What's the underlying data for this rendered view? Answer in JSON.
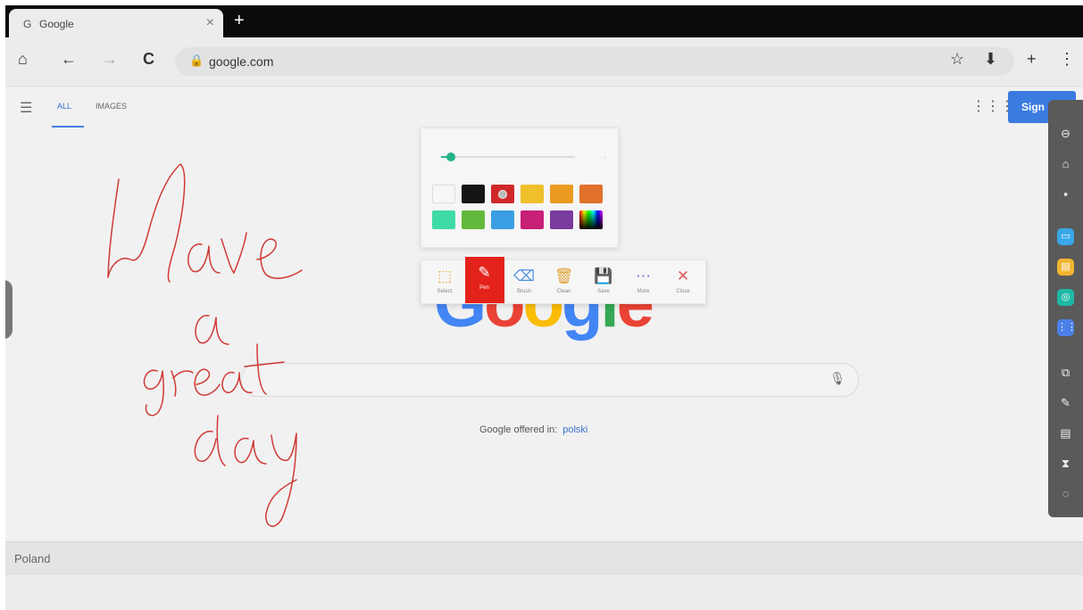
{
  "browser": {
    "tab": {
      "favicon": "G",
      "title": "Google",
      "close": "×"
    },
    "new_tab": "+",
    "toolbar": {
      "home": "⌂",
      "back": "←",
      "forward": "→",
      "reload": "C",
      "lock": "🔒",
      "url": "google.com",
      "star": "☆",
      "download": "⬇",
      "add": "+",
      "menu": "⋮"
    }
  },
  "google": {
    "nav": {
      "menu_icon": "☰",
      "all": "ALL",
      "images": "IMAGES"
    },
    "apps_icon": "⋮⋮⋮",
    "signin": "Sign",
    "logo_letters": [
      {
        "ch": "G",
        "color": "#4285f4"
      },
      {
        "ch": "o",
        "color": "#ea4335"
      },
      {
        "ch": "o",
        "color": "#fbbc05"
      },
      {
        "ch": "g",
        "color": "#4285f4"
      },
      {
        "ch": "l",
        "color": "#34a853"
      },
      {
        "ch": "e",
        "color": "#ea4335"
      }
    ],
    "mic_icon": "🎙",
    "offered_in": "Google offered in:",
    "language_link": "polski",
    "country": "Poland"
  },
  "annotation": {
    "palette": {
      "thickness": 0.07,
      "end_marker": "◦",
      "colors": [
        "#f7f7f7",
        "#141414",
        "#d0272b",
        "#f0c02c",
        "#eb9a21",
        "#e0702a",
        "#3fdba5",
        "#63b93c",
        "#3a9ee2",
        "#c81f77",
        "#7a3b9e",
        "spectrum"
      ],
      "selected_index": 2
    },
    "tools": [
      {
        "icon": "⬚",
        "label": "Select",
        "color": "#e0a33a",
        "active": false
      },
      {
        "icon": "✎",
        "label": "Pen",
        "color": "#ffffff",
        "active": true
      },
      {
        "icon": "⌫",
        "label": "Brush",
        "color": "#4d8fe0",
        "active": false
      },
      {
        "icon": "🗑",
        "label": "Clean",
        "color": "#e0a33a",
        "active": false
      },
      {
        "icon": "💾",
        "label": "Save",
        "color": "#3aae8f",
        "active": false
      },
      {
        "icon": "⋯",
        "label": "More",
        "color": "#7a6fd0",
        "active": false
      },
      {
        "icon": "✕",
        "label": "Close",
        "color": "#e05a5a",
        "active": false
      }
    ],
    "pen_color": "#d03a35"
  },
  "sidebar": {
    "items": [
      {
        "icon": "⊖",
        "bg": "none"
      },
      {
        "icon": "⌂",
        "bg": "none"
      },
      {
        "icon": "▪",
        "bg": "none"
      },
      {
        "icon": "▭",
        "bg": "#39a8e8"
      },
      {
        "icon": "▤",
        "bg": "#f1b531"
      },
      {
        "icon": "◎",
        "bg": "#1fb8a6"
      },
      {
        "icon": "⋮⋮",
        "bg": "#4d7fe8"
      },
      {
        "icon": "⧉",
        "bg": "none"
      },
      {
        "icon": "✎",
        "bg": "none"
      },
      {
        "icon": "▤",
        "bg": "none"
      },
      {
        "icon": "⧗",
        "bg": "none"
      },
      {
        "icon": "◌",
        "bg": "none"
      }
    ]
  }
}
